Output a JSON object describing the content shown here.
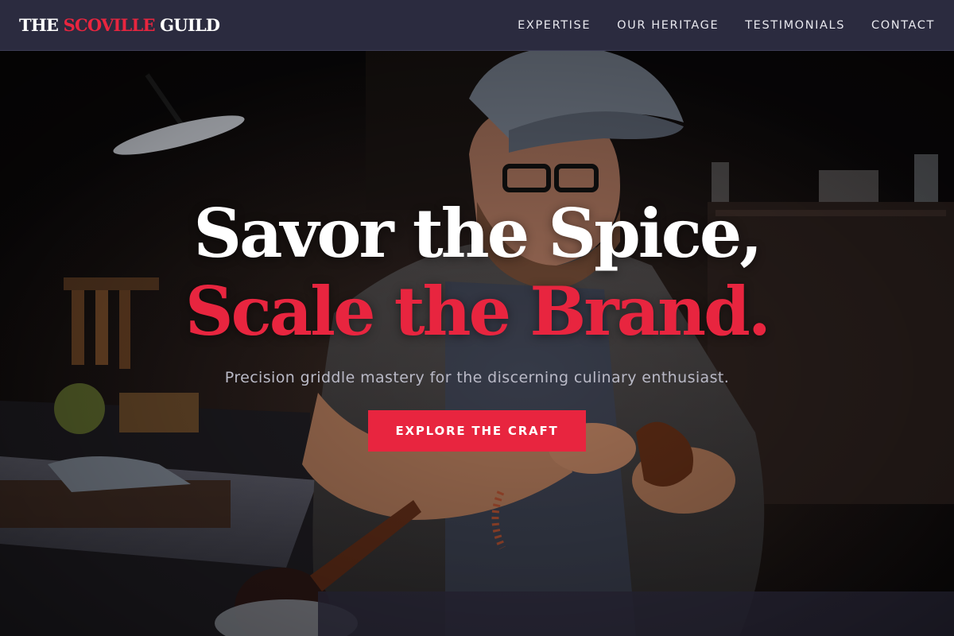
{
  "brand": {
    "part1": "THE ",
    "part2": "SCOVILLE",
    "part3": " GUILD",
    "accent_color": "#e8253f"
  },
  "nav": {
    "items": [
      {
        "label": "EXPERTISE"
      },
      {
        "label": "OUR HERITAGE"
      },
      {
        "label": "TESTIMONIALS"
      },
      {
        "label": "CONTACT"
      }
    ]
  },
  "hero": {
    "headline_line1": "Savor the Spice,",
    "headline_line2": "Scale the Brand.",
    "subtitle": "Precision griddle mastery for the discerning culinary enthusiast.",
    "cta_label": "EXPLORE THE CRAFT",
    "background_image": "photo-craftsman-in-cap-working-at-bench"
  }
}
